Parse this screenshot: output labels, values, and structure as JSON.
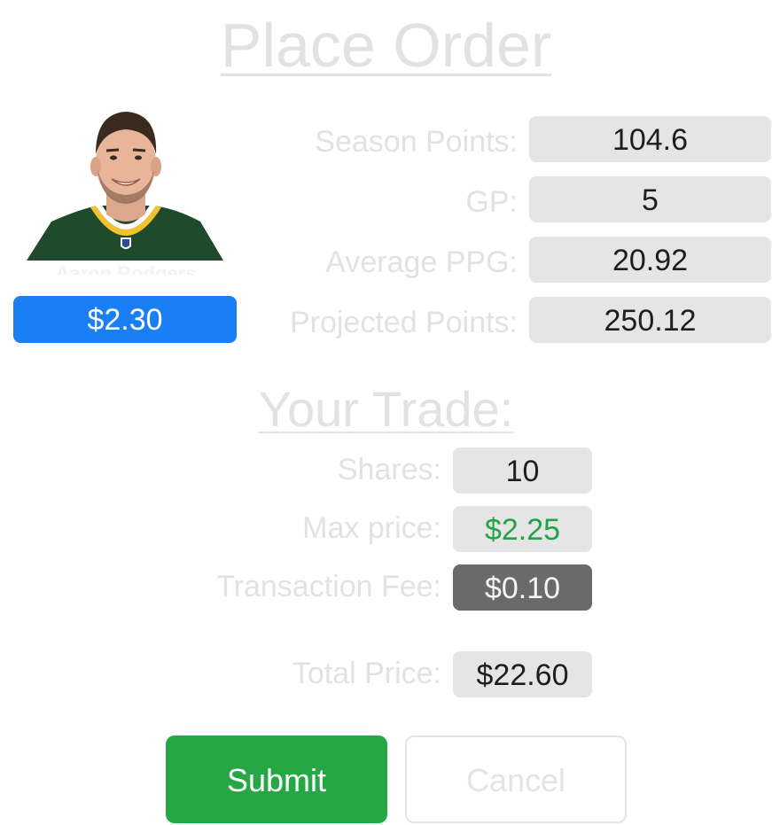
{
  "header": {
    "title": "Place Order"
  },
  "player": {
    "name_partial": "Aaron Rodgers",
    "price": "$2.30",
    "colors": {
      "jersey": "#1f4a2c",
      "trim": "#f2c12e",
      "badge": "#1a7ff5"
    }
  },
  "stats": {
    "season_points": {
      "label": "Season Points:",
      "value": "104.6"
    },
    "gp": {
      "label": "GP:",
      "value": "5"
    },
    "average_ppg": {
      "label": "Average PPG:",
      "value": "20.92"
    },
    "projected_points": {
      "label": "Projected Points:",
      "value": "250.12"
    }
  },
  "trade": {
    "title": "Your Trade:",
    "shares": {
      "label": "Shares:",
      "value": "10"
    },
    "max_price": {
      "label": "Max price:",
      "value": "$2.25"
    },
    "transaction_fee": {
      "label": "Transaction Fee:",
      "value": "$0.10"
    },
    "total_price": {
      "label": "Total Price:",
      "value": "$22.60"
    }
  },
  "actions": {
    "submit_label": "Submit",
    "cancel_label": "Cancel"
  },
  "colors": {
    "submit": "#25a745",
    "green_value": "#22a447",
    "fee_bg": "#6a6a6a"
  }
}
